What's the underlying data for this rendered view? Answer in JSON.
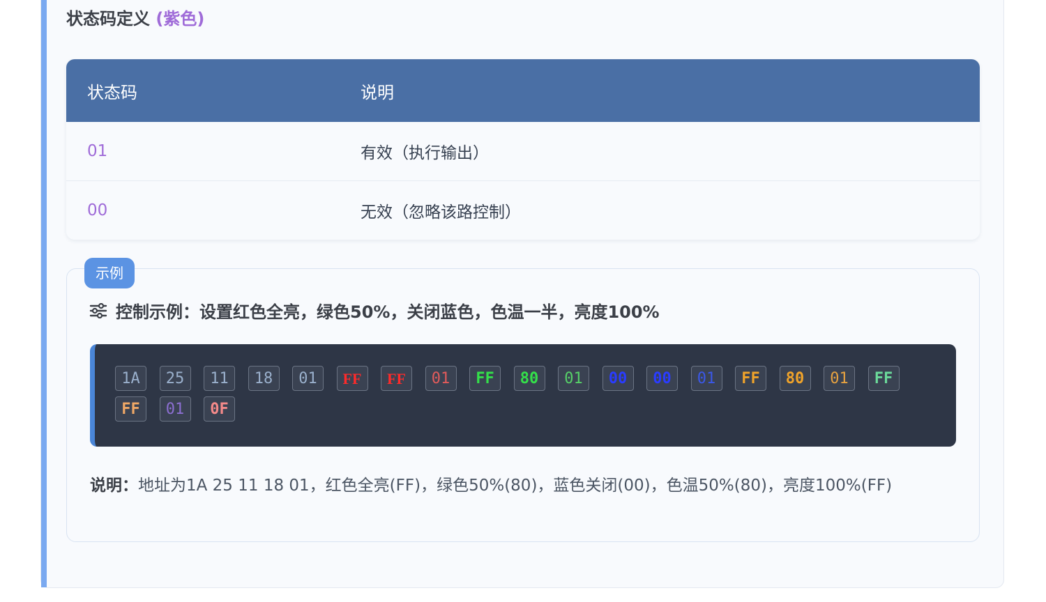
{
  "section": {
    "title": "状态码定义",
    "title_highlight": "(紫色)"
  },
  "status_table": {
    "headers": [
      "状态码",
      "说明"
    ],
    "rows": [
      {
        "code": "01",
        "desc": "有效（执行输出）"
      },
      {
        "code": "00",
        "desc": "无效（忽略该路控制）"
      }
    ]
  },
  "example": {
    "badge": "示例",
    "icon": "sliders-icon",
    "title": "控制示例：设置红色全亮，绿色50%，关闭蓝色，色温一半，亮度100%",
    "bytes": [
      "1A",
      "25",
      "11",
      "18",
      "01",
      "FF",
      "FF",
      "01",
      "FF",
      "80",
      "01",
      "00",
      "00",
      "01",
      "FF",
      "80",
      "01",
      "FF",
      "FF",
      "01",
      "0F"
    ],
    "note_label": "说明：",
    "note_text": "地址为1A 25 11 18 01，红色全亮(FF)，绿色50%(80)，蓝色关闭(00)，色温50%(80)，亮度100%(FF)"
  },
  "colors": {
    "header_bg": "#4a6fa5",
    "accent": "#7aa9f0",
    "purple": "#9f6bd8",
    "badge": "#5b93e3",
    "code_bg": "#2e3646"
  }
}
